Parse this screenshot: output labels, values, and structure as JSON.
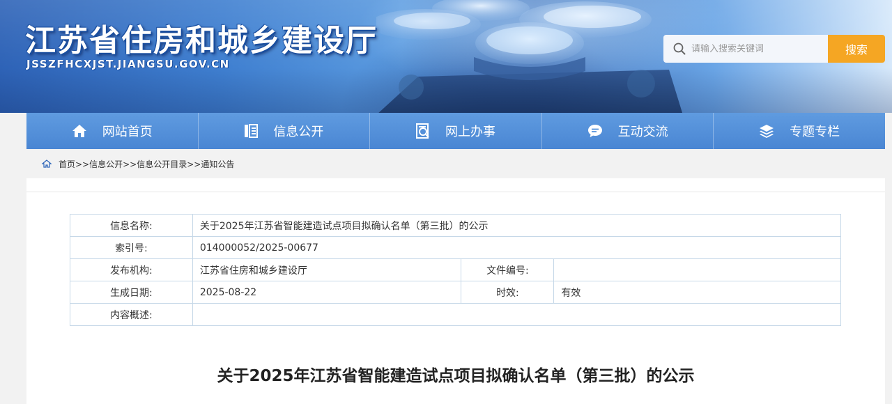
{
  "header": {
    "title": "江苏省住房和城乡建设厅",
    "domain": "JSSZFHCXJST.JIANGSU.GOV.CN"
  },
  "search": {
    "placeholder": "请输入搜索关键词",
    "button_label": "搜索"
  },
  "nav": {
    "items": [
      {
        "label": "网站首页",
        "icon": "home-icon"
      },
      {
        "label": "信息公开",
        "icon": "document-list-icon"
      },
      {
        "label": "网上办事",
        "icon": "service-icon"
      },
      {
        "label": "互动交流",
        "icon": "chat-bubble-icon"
      },
      {
        "label": "专题专栏",
        "icon": "layers-icon"
      }
    ]
  },
  "breadcrumb": {
    "text": "首页>>信息公开>>信息公开目录>>通知公告"
  },
  "info": {
    "name_label": "信息名称:",
    "name_value": "关于2025年江苏省智能建造试点项目拟确认名单（第三批）的公示",
    "index_label": "索引号:",
    "index_value": "014000052/2025-00677",
    "publisher_label": "发布机构:",
    "publisher_value": "江苏省住房和城乡建设厅",
    "docno_label": "文件编号:",
    "docno_value": "",
    "date_label": "生成日期:",
    "date_value": "2025-08-22",
    "validity_label": "时效:",
    "validity_value": "有效",
    "summary_label": "内容概述:",
    "summary_value": ""
  },
  "article": {
    "title": "关于2025年江苏省智能建造试点项目拟确认名单（第三批）的公示"
  },
  "colors": {
    "nav_bg": "#5592da",
    "search_button": "#f5a623",
    "table_border": "#c6d8e8"
  }
}
